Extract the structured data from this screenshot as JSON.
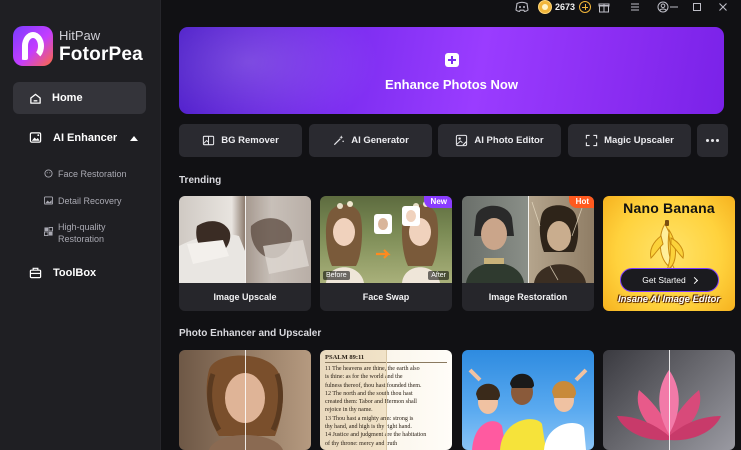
{
  "app": {
    "brand_top": "HitPaw",
    "brand_name": "FotorPea"
  },
  "sidebar": {
    "home": "Home",
    "ai_enhancer": "AI Enhancer",
    "sub_items": [
      "Face Restoration",
      "Detail Recovery",
      "High-quality",
      "Restoration"
    ],
    "toolbox": "ToolBox"
  },
  "titlebar": {
    "credits": "2673"
  },
  "hero": {
    "label": "Enhance Photos Now"
  },
  "tools": [
    "BG Remover",
    "AI Generator",
    "AI Photo Editor",
    "Magic Upscaler"
  ],
  "trending": {
    "title": "Trending",
    "cards": [
      {
        "caption": "Image Upscale"
      },
      {
        "caption": "Face Swap",
        "badge": "New",
        "before": "Before",
        "after": "After"
      },
      {
        "caption": "Image Restoration",
        "badge": "Hot"
      }
    ],
    "promo": {
      "title": "Nano Banana",
      "button": "Get Started",
      "subtitle": "Insane AI Image Editor"
    }
  },
  "enhancer": {
    "title": "Photo Enhancer and Upscaler",
    "book_header": "PSALM 89:11",
    "book_lines": [
      "11 The heavens are thine, the earth also",
      "is thine: as for the world and the",
      "fulness thereof, thou hast founded them.",
      "12 The north and the south thou hast",
      "created them: Tabor and Hermon shall",
      "rejoice in thy name.",
      "13 Thou hast a mighty arm: strong is",
      "thy hand, and high is thy right hand.",
      "14 Justice and judgment are the habitation",
      "of thy throne: mercy and truth"
    ]
  },
  "colors": {
    "accent": "#8a2df2",
    "coin": "#f1b53a",
    "new_badge": "#8a3cff",
    "hot_badge": "#ff5a1f"
  }
}
